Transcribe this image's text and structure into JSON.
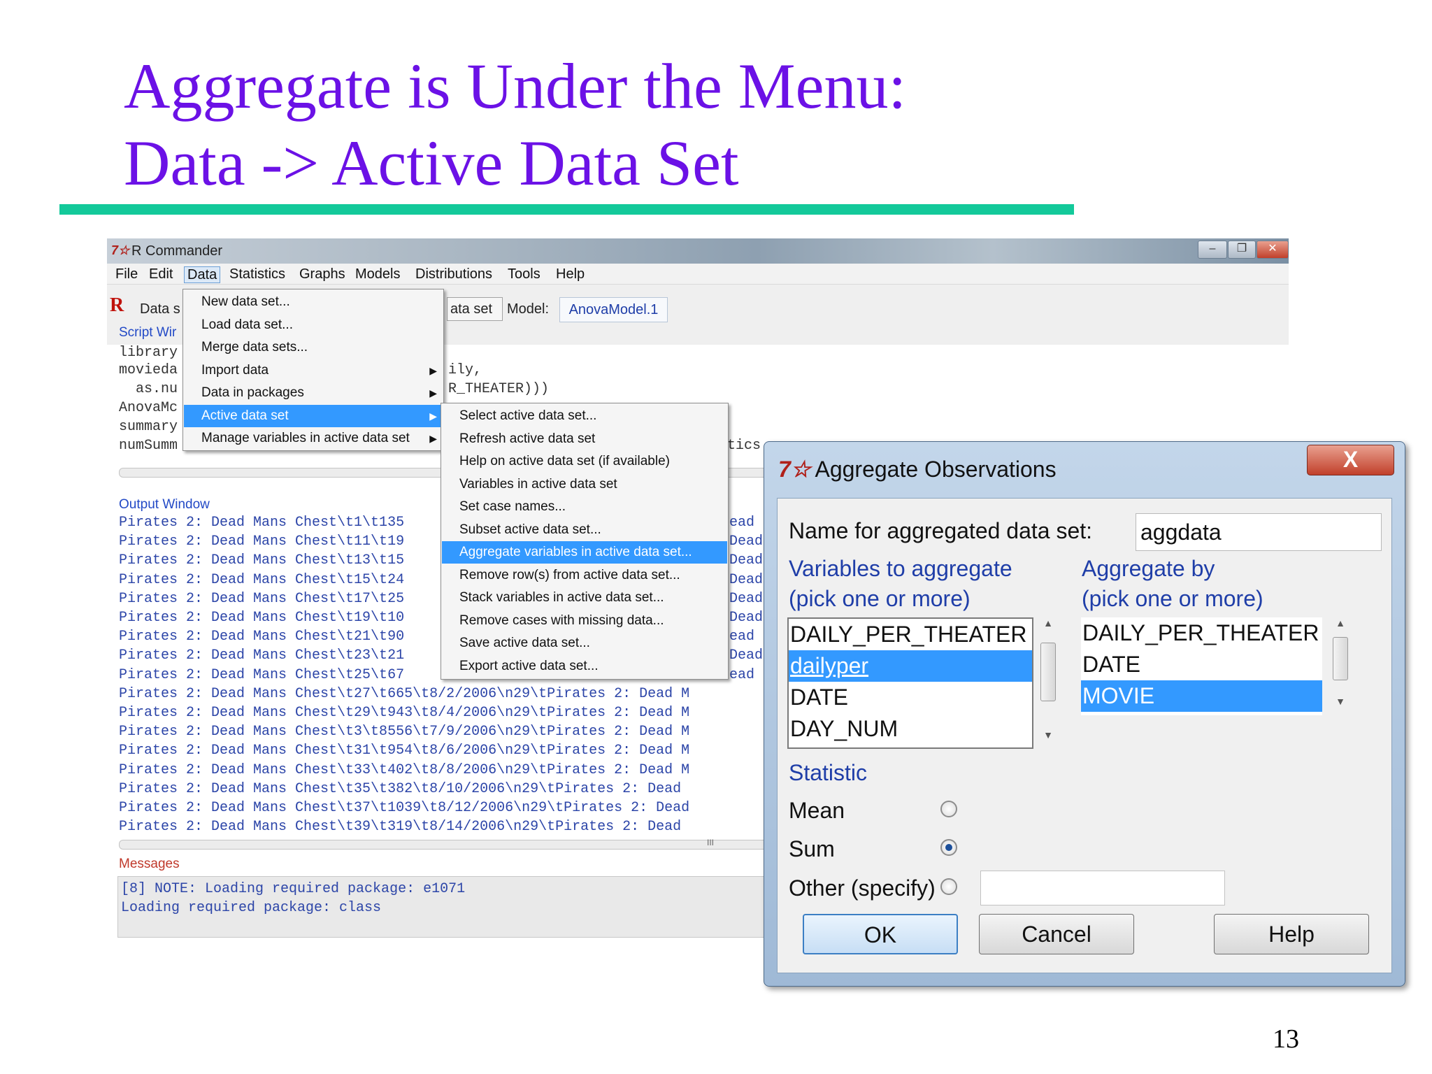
{
  "slide": {
    "title_line1": "Aggregate is Under the Menu:",
    "title_line2": "Data -> Active Data Set",
    "page_number": "13",
    "colors": {
      "title": "#6b11e6",
      "rule": "#13c99a"
    }
  },
  "rcmdr": {
    "title": "R Commander",
    "menubar": [
      "File",
      "Edit",
      "Data",
      "Statistics",
      "Graphs",
      "Models",
      "Distributions",
      "Tools",
      "Help"
    ],
    "toolbar": {
      "dataset_label": "Data s",
      "dataset_button": "ata set",
      "model_label": "Model:",
      "model_value": "AnovaModel.1"
    },
    "script_window_label": "Script Wir",
    "script_lines": [
      "library",
      "movieda",
      "  as.nu",
      "AnovaMc",
      "summary",
      "numSumm"
    ],
    "script_fragments": [
      "ily,",
      "R_THEATER)))",
      "tics"
    ],
    "output_window_label": "Output Window",
    "output_lines": [
      "Pirates 2: Dead Mans Chest\\t1\\t135",
      "Pirates 2: Dead Mans Chest\\t11\\t19",
      "Pirates 2: Dead Mans Chest\\t13\\t15",
      "Pirates 2: Dead Mans Chest\\t15\\t24",
      "Pirates 2: Dead Mans Chest\\t17\\t25",
      "Pirates 2: Dead Mans Chest\\t19\\t10",
      "Pirates 2: Dead Mans Chest\\t21\\t90",
      "Pirates 2: Dead Mans Chest\\t23\\t21",
      "Pirates 2: Dead Mans Chest\\t25\\t67",
      "Pirates 2: Dead Mans Chest\\t27\\t665\\t8/2/2006\\n29\\tPirates 2: Dead M",
      "Pirates 2: Dead Mans Chest\\t29\\t943\\t8/4/2006\\n29\\tPirates 2: Dead M",
      "Pirates 2: Dead Mans Chest\\t3\\t8556\\t7/9/2006\\n29\\tPirates 2: Dead M",
      "Pirates 2: Dead Mans Chest\\t31\\t954\\t8/6/2006\\n29\\tPirates 2: Dead M",
      "Pirates 2: Dead Mans Chest\\t33\\t402\\t8/8/2006\\n29\\tPirates 2: Dead M",
      "Pirates 2: Dead Mans Chest\\t35\\t382\\t8/10/2006\\n29\\tPirates 2: Dead",
      "Pirates 2: Dead Mans Chest\\t37\\t1039\\t8/12/2006\\n29\\tPirates 2: Dead",
      "Pirates 2: Dead Mans Chest\\t39\\t319\\t8/14/2006\\n29\\tPirates 2: Dead"
    ],
    "output_right_fragments": [
      "ead",
      "Dead",
      "Dead",
      "Dead",
      "Dead",
      "Dead",
      "ead",
      "Dead",
      "ead"
    ],
    "messages_label": "Messages",
    "messages": [
      "[8] NOTE: Loading required package: e1071",
      "Loading required package: class"
    ],
    "scrollbar_grip": "III"
  },
  "data_menu": {
    "items": [
      {
        "label": "New data set...",
        "submenu": false
      },
      {
        "label": "Load data set...",
        "submenu": false
      },
      {
        "label": "Merge data sets...",
        "submenu": false
      },
      {
        "label": "Import data",
        "submenu": true
      },
      {
        "label": "Data in packages",
        "submenu": true
      },
      {
        "label": "Active data set",
        "submenu": true,
        "highlighted": true
      },
      {
        "label": "Manage variables in active data set",
        "submenu": true
      }
    ],
    "arrow": "▶"
  },
  "active_submenu": {
    "items": [
      {
        "label": "Select active data set..."
      },
      {
        "label": "Refresh active data set"
      },
      {
        "label": "Help on active data set (if available)"
      },
      {
        "label": "Variables in active data set"
      },
      {
        "label": "Set case names..."
      },
      {
        "label": "Subset active data set..."
      },
      {
        "label": "Aggregate variables in active data set...",
        "highlighted": true
      },
      {
        "label": "Remove row(s) from active data set..."
      },
      {
        "label": "Stack variables in active data set..."
      },
      {
        "label": "Remove cases with missing data..."
      },
      {
        "label": "Save active data set..."
      },
      {
        "label": "Export active data set..."
      }
    ]
  },
  "dialog": {
    "title": "Aggregate Observations",
    "close_label": "X",
    "name_label": "Name for aggregated data set:",
    "name_value": "aggdata",
    "vars_label_1": "Variables to aggregate",
    "vars_label_2": "(pick one or more)",
    "by_label_1": "Aggregate by",
    "by_label_2": "(pick one or more)",
    "vars_options": [
      {
        "label": "DAILY_PER_THEATER",
        "selected": false
      },
      {
        "label": "dailyper",
        "selected": true
      },
      {
        "label": "DATE",
        "selected": false
      },
      {
        "label": "DAY_NUM",
        "selected": false
      }
    ],
    "by_options": [
      {
        "label": "DAILY_PER_THEATER",
        "selected": false
      },
      {
        "label": "DATE",
        "selected": false
      },
      {
        "label": "MOVIE",
        "selected": true
      }
    ],
    "statistic_label": "Statistic",
    "statistics": [
      {
        "label": "Mean",
        "checked": false
      },
      {
        "label": "Sum",
        "checked": true
      },
      {
        "label": "Other (specify)",
        "checked": false
      }
    ],
    "other_value": "",
    "buttons": {
      "ok": "OK",
      "cancel": "Cancel",
      "help": "Help"
    },
    "selection_color": "#3399ff"
  }
}
